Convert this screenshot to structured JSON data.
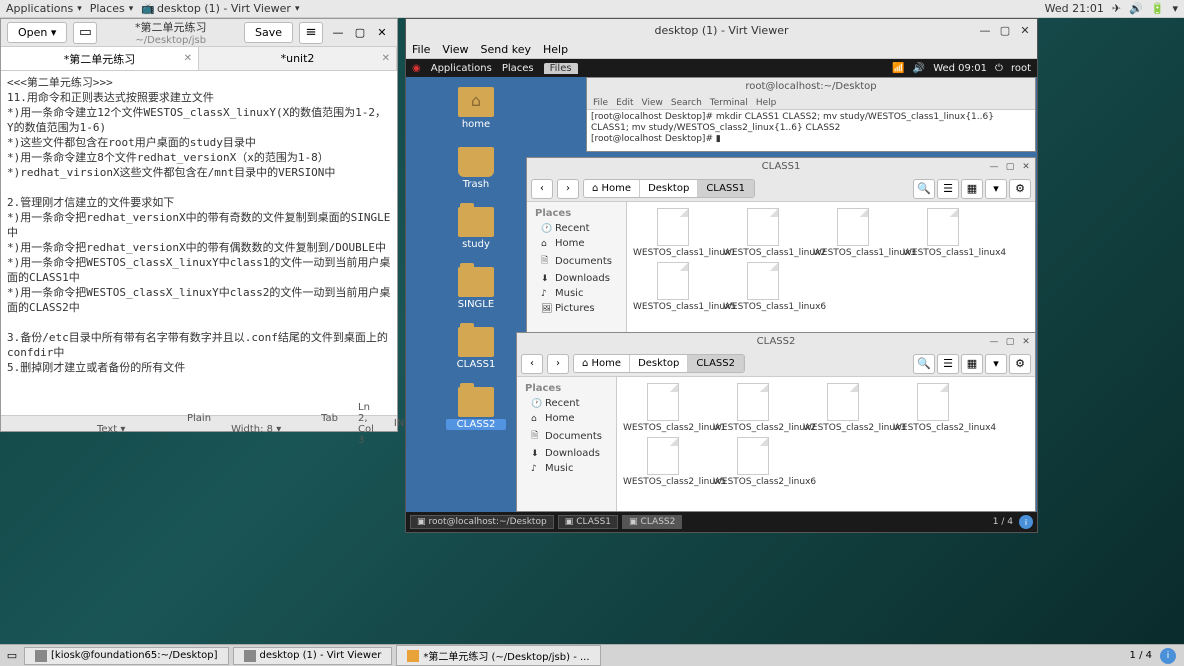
{
  "host_panel": {
    "applications": "Applications",
    "places": "Places",
    "virt_app": "desktop (1) - Virt Viewer",
    "clock": "Wed 21:01"
  },
  "host_taskbar": {
    "items": [
      "[kiosk@foundation65:~/Desktop]",
      "desktop (1) - Virt Viewer",
      "*第二单元练习 (~/Desktop/jsb) - ..."
    ],
    "workspace": "1 / 4"
  },
  "gedit": {
    "open": "Open",
    "save": "Save",
    "title": "*第二单元练习",
    "subtitle": "~/Desktop/jsb",
    "tabs": [
      "*第二单元练习",
      "*unit2"
    ],
    "body": "<<<第二单元练习>>>\n11.用命令和正则表达式按照要求建立文件\n*)用一条命令建立12个文件WESTOS_classX_linuxY(X的数值范围为1-2，Y的数值范围为1-6)\n*)这些文件都包含在root用户桌面的study目录中\n*)用一条命令建立8个文件redhat_versionX（x的范围为1-8）\n*)redhat_virsionX这些文件都包含在/mnt目录中的VERSION中\n\n2.管理刚才信建立的文件要求如下\n*)用一条命令把redhat_versionX中的带有奇数的文件复制到桌面的SINGLE中\n*)用一条命令把redhat_versionX中的带有偶数数的文件复制到/DOUBLE中\n*)用一条命令把WESTOS_classX_linuxY中class1的文件一动到当前用户桌面的CLASS1中\n*)用一条命令把WESTOS_classX_linuxY中class2的文件一动到当前用户桌面的CLASS2中\n\n3.备份/etc目录中所有带有名字带有数字并且以.conf结尾的文件到桌面上的confdir中\n5.删掉刚才建立或者备份的所有文件",
    "status": {
      "lang": "Plain Text",
      "tab": "Tab Width: 8",
      "pos": "Ln 2, Col 3",
      "ins": "INS"
    }
  },
  "virt": {
    "title": "desktop (1) - Virt Viewer",
    "menu": [
      "File",
      "View",
      "Send key",
      "Help"
    ]
  },
  "guest_panel": {
    "applications": "Applications",
    "places": "Places",
    "files": "Files",
    "clock": "Wed 09:01",
    "user": "root"
  },
  "desktop_icons": [
    {
      "label": "home",
      "type": "home"
    },
    {
      "label": "Trash",
      "type": "trash"
    },
    {
      "label": "study",
      "type": "folder"
    },
    {
      "label": "SINGLE",
      "type": "folder"
    },
    {
      "label": "CLASS1",
      "type": "folder"
    },
    {
      "label": "CLASS2",
      "type": "folder",
      "selected": true
    }
  ],
  "terminal": {
    "title": "root@localhost:~/Desktop",
    "menu": [
      "File",
      "Edit",
      "View",
      "Search",
      "Terminal",
      "Help"
    ],
    "line1": "[root@localhost Desktop]# mkdir CLASS1 CLASS2; mv study/WESTOS_class1_linux{1..6} CLASS1; mv study/WESTOS_class2_linux{1..6} CLASS2",
    "line2": "[root@localhost Desktop]# "
  },
  "fm_class1": {
    "title": "CLASS1",
    "path": [
      "⌂ Home",
      "Desktop",
      "CLASS1"
    ],
    "sidebar_header": "Places",
    "sidebar": [
      "Recent",
      "Home",
      "Documents",
      "Downloads",
      "Music",
      "Pictures"
    ],
    "files": [
      "WESTOS_class1_linux1",
      "WESTOS_class1_linux2",
      "WESTOS_class1_linux3",
      "WESTOS_class1_linux4",
      "WESTOS_class1_linux5",
      "WESTOS_class1_linux6"
    ]
  },
  "fm_class2": {
    "title": "CLASS2",
    "path": [
      "⌂ Home",
      "Desktop",
      "CLASS2"
    ],
    "sidebar_header": "Places",
    "sidebar": [
      "Recent",
      "Home",
      "Documents",
      "Downloads",
      "Music"
    ],
    "files": [
      "WESTOS_class2_linux1",
      "WESTOS_class2_linux2",
      "WESTOS_class2_linux3",
      "WESTOS_class2_linux4",
      "WESTOS_class2_linux5",
      "WESTOS_class2_linux6"
    ]
  },
  "guest_taskbar": {
    "items": [
      "root@localhost:~/Desktop",
      "CLASS1",
      "CLASS2"
    ],
    "workspace": "1 / 4"
  }
}
